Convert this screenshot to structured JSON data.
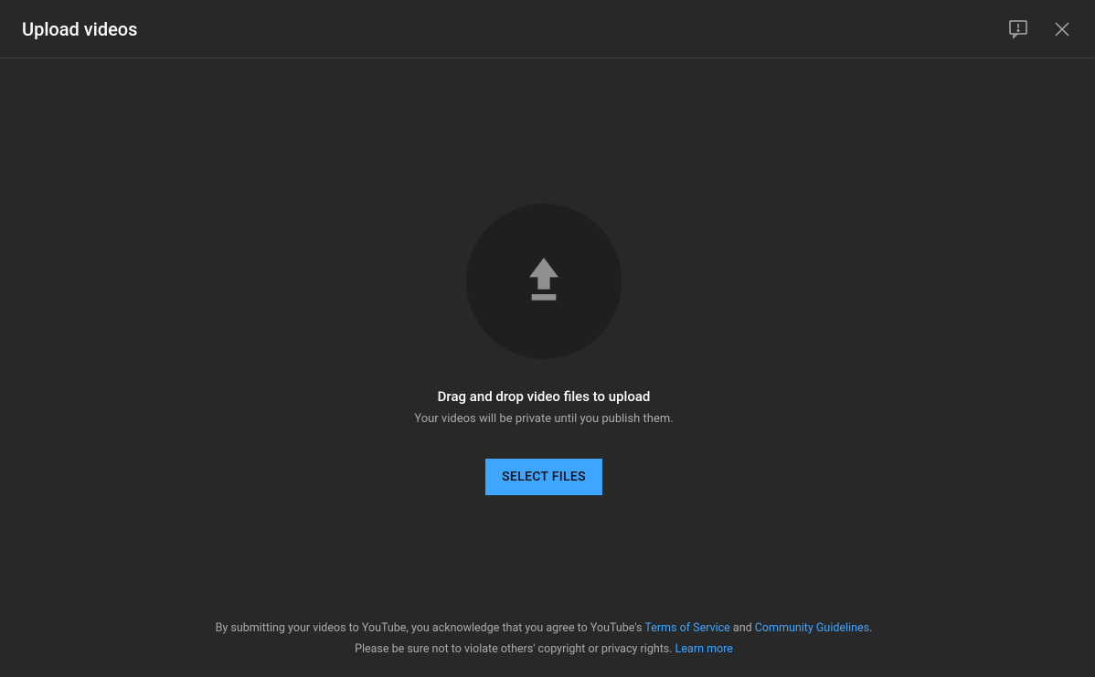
{
  "header": {
    "title": "Upload videos"
  },
  "upload": {
    "heading": "Drag and drop video files to upload",
    "subheading": "Your videos will be private until you publish them.",
    "button_label": "SELECT FILES"
  },
  "footer": {
    "line1_prefix": "By submitting your videos to YouTube, you acknowledge that you agree to YouTube's ",
    "terms_link": "Terms of Service",
    "and": " and ",
    "guidelines_link": "Community Guidelines",
    "line1_suffix": ".",
    "line2_prefix": "Please be sure not to violate others' copyright or privacy rights. ",
    "learn_more": "Learn more"
  },
  "colors": {
    "accent": "#3ea6ff",
    "background": "#282828"
  }
}
